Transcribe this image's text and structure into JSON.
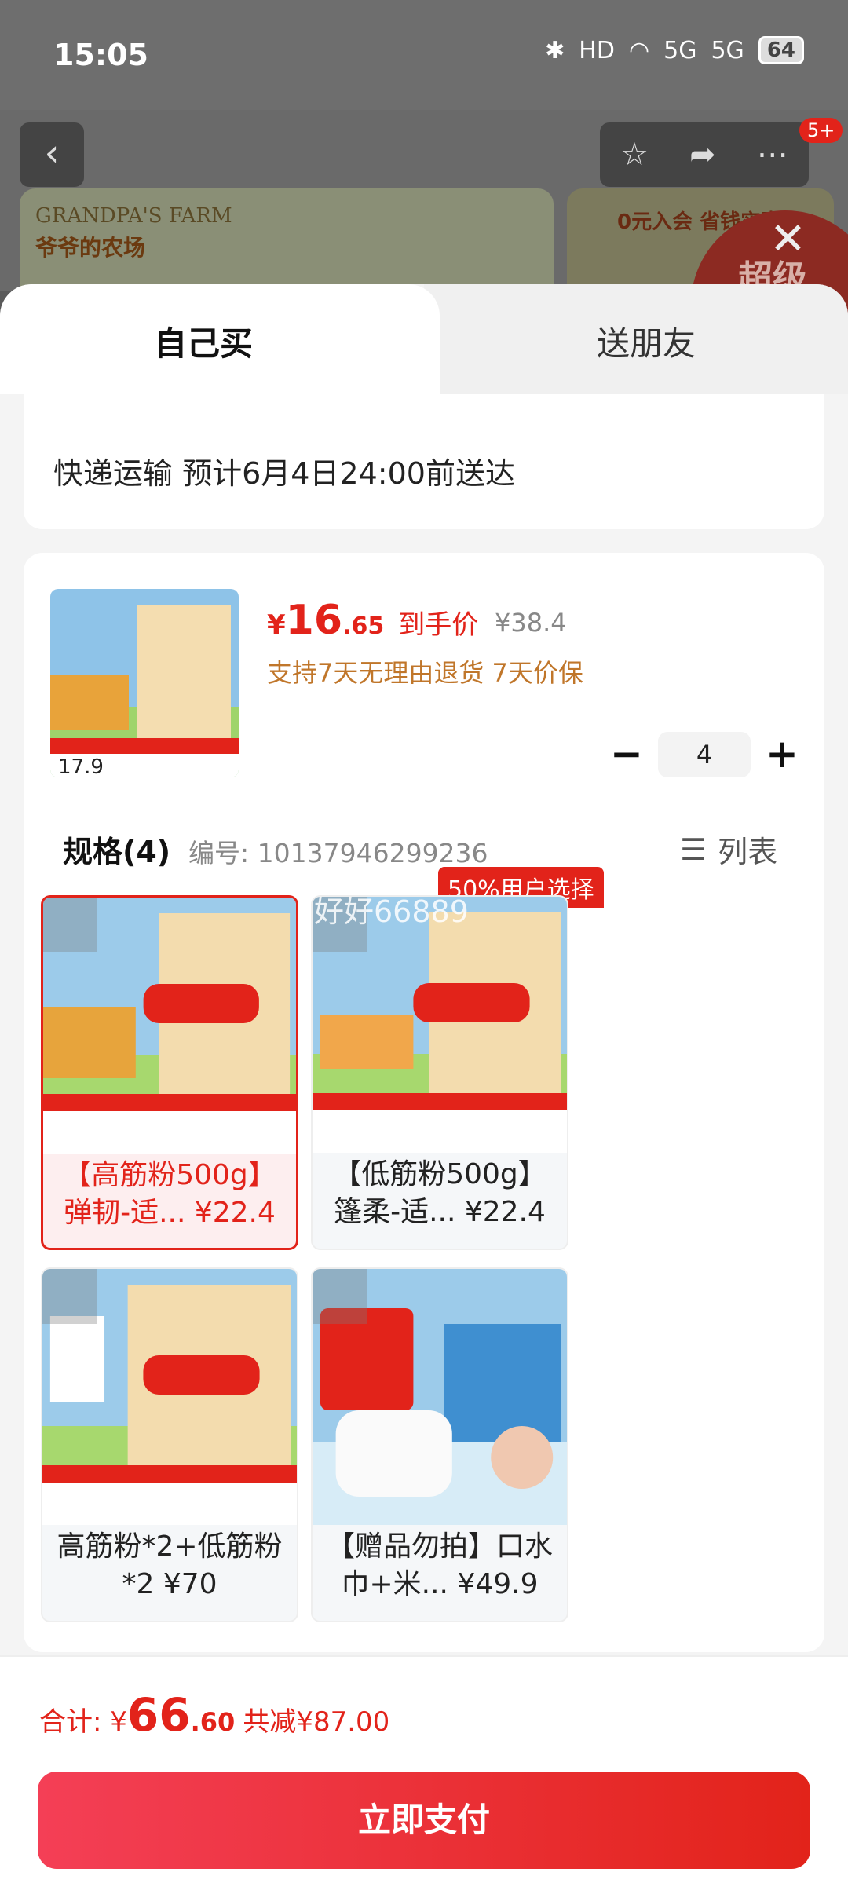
{
  "status": {
    "time": "15:05",
    "battery": "64",
    "hd": "HD",
    "net1": "5G",
    "net2": "5G"
  },
  "nav": {
    "cart_count": "5+"
  },
  "banner": {
    "brand_en": "GRANDPA'S FARM",
    "brand_cn": "爷爷的农场",
    "promo_text": "0元入会 省钱实惠",
    "promo_circle": "超级"
  },
  "tabs": {
    "self": "自己买",
    "friend": "送朋友"
  },
  "delivery": {
    "text": "快递运输 预计6月4日24:00前送达"
  },
  "product": {
    "currency": "¥",
    "price_int": "16",
    "price_dec": ".65",
    "price_label": "到手价",
    "original_price": "¥38.4",
    "support": "支持7天无理由退货  7天价保",
    "quantity": "4"
  },
  "spec": {
    "title": "规格(4)",
    "code": "编号: 10137946299236",
    "list_label": "列表",
    "choice_tag": "50%用户选择",
    "items": [
      {
        "label": "【高筋粉500g】弹韧-适... ¥22.4"
      },
      {
        "label": "【低筋粉500g】篷柔-适... ¥22.4"
      },
      {
        "label": "高筋粉*2+低筋粉*2 ¥70"
      },
      {
        "label": "【赠品勿拍】口水巾+米... ¥49.9"
      }
    ]
  },
  "watermark": "好好66889",
  "footer": {
    "total_label": "合计: ¥",
    "total_int": "66",
    "total_dec": ".60",
    "discount": "共减¥87.00",
    "pay_label": "立即支付"
  },
  "colors": {
    "accent": "#e2231a",
    "support": "#c0762a"
  }
}
